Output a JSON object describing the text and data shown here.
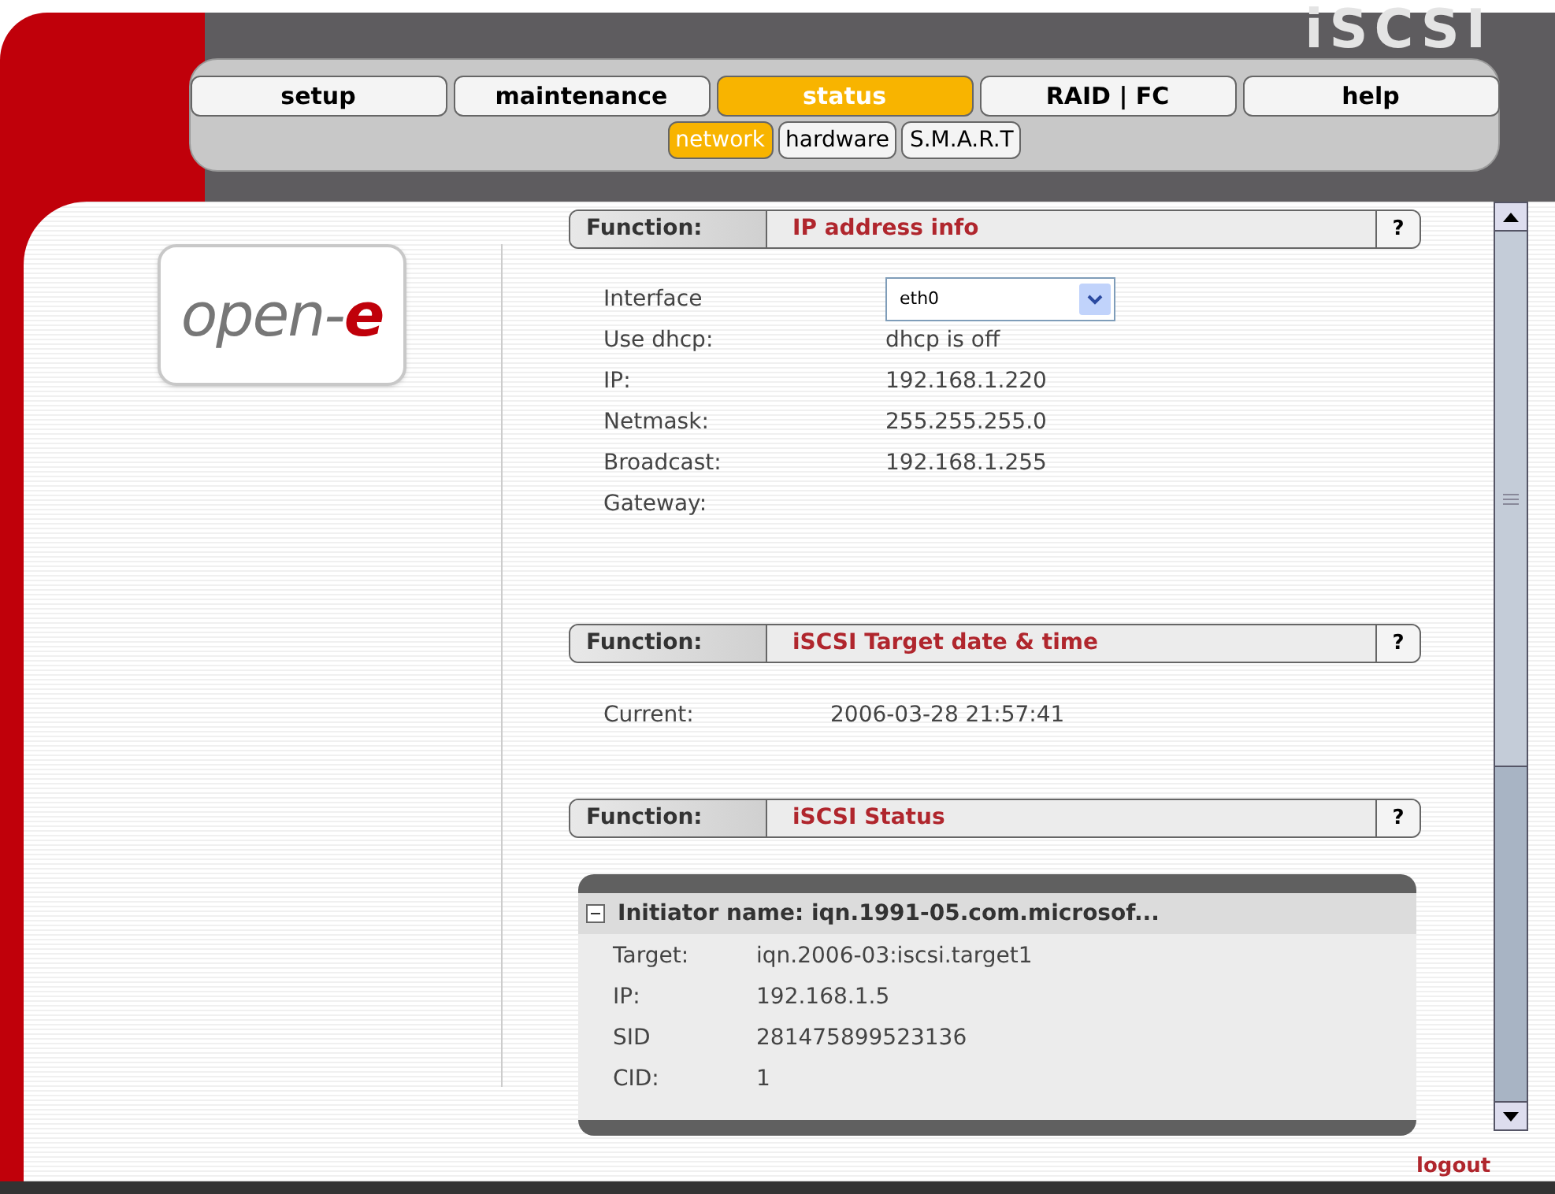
{
  "brand": "iSCSI",
  "tabs": [
    {
      "label": "setup",
      "selected": false
    },
    {
      "label": "maintenance",
      "selected": false
    },
    {
      "label": "status",
      "selected": true
    },
    {
      "label": "RAID | FC",
      "selected": false
    },
    {
      "label": "help",
      "selected": false
    }
  ],
  "subtabs": [
    {
      "label": "network",
      "selected": true
    },
    {
      "label": "hardware",
      "selected": false
    },
    {
      "label": "S.M.A.R.T",
      "selected": false
    }
  ],
  "logo": {
    "text": "open-",
    "accent": "e"
  },
  "sections": [
    {
      "label": "Function:",
      "title": "IP address info",
      "help": "?",
      "rows": [
        {
          "kind": "select",
          "label": "Interface",
          "value": "eth0"
        },
        {
          "kind": "text",
          "label": "Use dhcp:",
          "value": "dhcp is off"
        },
        {
          "kind": "text",
          "label": "IP:",
          "value": "192.168.1.220"
        },
        {
          "kind": "text",
          "label": "Netmask:",
          "value": "255.255.255.0"
        },
        {
          "kind": "text",
          "label": "Broadcast:",
          "value": "192.168.1.255"
        },
        {
          "kind": "text",
          "label": "Gateway:"
        }
      ]
    },
    {
      "label": "Function:",
      "title": "iSCSI Target date & time",
      "help": "?",
      "rows": [
        {
          "kind": "text",
          "label": "Current:",
          "value": "2006-03-28 21:57:41"
        }
      ]
    },
    {
      "label": "Function:",
      "title": "iSCSI Status",
      "help": "?",
      "initiator": {
        "expanded": true,
        "title": "Initiator name: iqn.1991-05.com.microsof...",
        "rows": [
          {
            "label": "Target:",
            "value": "iqn.2006-03:iscsi.target1"
          },
          {
            "label": "IP:",
            "value": "192.168.1.5"
          },
          {
            "label": "SID",
            "value": "281475899523136"
          },
          {
            "label": "CID:",
            "value": "1"
          }
        ]
      }
    }
  ],
  "logout": "logout"
}
